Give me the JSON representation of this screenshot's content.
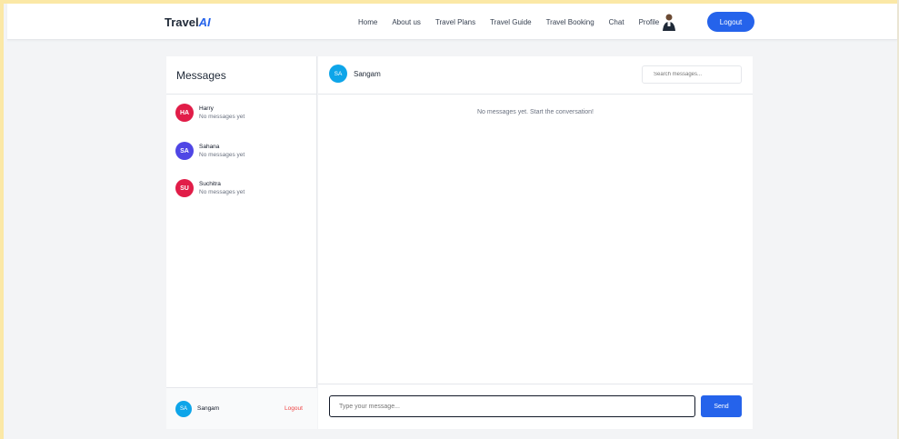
{
  "navbar": {
    "brand_prefix": "Travel",
    "brand_suffix": "AI",
    "links": [
      "Home",
      "About us",
      "Travel Plans",
      "Travel Guide",
      "Travel Booking",
      "Chat"
    ],
    "profile_label": "Profile",
    "logout_label": "Logout"
  },
  "sidebar": {
    "title": "Messages",
    "contacts": [
      {
        "initials": "HA",
        "name": "Harry",
        "preview": "No messages yet",
        "color": "#e11d48"
      },
      {
        "initials": "SA",
        "name": "Sahana",
        "preview": "No messages yet",
        "color": "#4f46e5"
      },
      {
        "initials": "SU",
        "name": "Suchitra",
        "preview": "No messages yet",
        "color": "#e11d48"
      }
    ],
    "footer": {
      "initials": "SA",
      "name": "Sangam",
      "logout_label": "Logout"
    }
  },
  "chat": {
    "contact_initials": "SA",
    "contact_name": "Sangam",
    "search_placeholder": "Search messages...",
    "empty_text": "No messages yet. Start the conversation!",
    "input_placeholder": "Type your message...",
    "send_label": "Send"
  },
  "colors": {
    "accent": "#2563eb",
    "avatar_blue": "#0ea5e9",
    "logout_red": "#ef4444"
  }
}
